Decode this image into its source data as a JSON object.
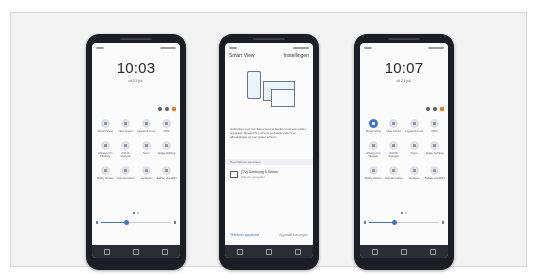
{
  "phones": [
    {
      "clock": "10:03",
      "date": "di 21 jul.",
      "tiles": [
        {
          "label": "Smart View",
          "active": false
        },
        {
          "label": "Niet storen",
          "active": false
        },
        {
          "label": "Liggend mod.",
          "active": false
        },
        {
          "label": "NFC",
          "active": false
        },
        {
          "label": "Always On Display",
          "active": false
        },
        {
          "label": "Zichtb. wijzigen",
          "active": false
        },
        {
          "label": "Sync",
          "active": false
        },
        {
          "label": "Edge lighting",
          "active": false
        },
        {
          "label": "Dolby Atmos",
          "active": false
        },
        {
          "label": "Gamemodus",
          "active": false
        },
        {
          "label": "Hotspot",
          "active": false
        },
        {
          "label": "Bellen via WiFi",
          "active": false
        }
      ],
      "brightness": 0.35
    },
    {
      "smart_view": {
        "title": "Smart View",
        "settings": "Instellingen",
        "description": "Gebruiken voor het delen van uw telefoon met een ander apparaat. Spiegel het scherm en bekijk video's en afbeeldingen op een groter scherm.",
        "section": "Beschikbare apparaten",
        "device_name": "[TV] Samsung 6 Series",
        "device_sub": "Scherm spiegelen",
        "bottom_left": "Telefoon apparaat",
        "bottom_right": "Apparaat toevoegen"
      }
    },
    {
      "clock": "10:07",
      "date": "di 21 jul.",
      "tiles": [
        {
          "label": "Smart View",
          "active": true
        },
        {
          "label": "Niet storen",
          "active": false
        },
        {
          "label": "Liggend mod.",
          "active": false
        },
        {
          "label": "NFC",
          "active": false
        },
        {
          "label": "Always On Display",
          "active": false
        },
        {
          "label": "Zichtb. wijzigen",
          "active": false
        },
        {
          "label": "Sync",
          "active": false
        },
        {
          "label": "Edge lighting",
          "active": false
        },
        {
          "label": "Dolby Atmos",
          "active": false
        },
        {
          "label": "Gamemodus",
          "active": false
        },
        {
          "label": "Hotspot",
          "active": false
        },
        {
          "label": "Bellen via WiFi",
          "active": false
        }
      ],
      "brightness": 0.35
    }
  ],
  "colors": {
    "accent": "#3f72c9",
    "notification": "#f07a1f",
    "bezel": "#1b1e24"
  },
  "icons": {
    "quick_settings": [
      "settings-gear-icon",
      "more-dots-icon",
      "notification-icon"
    ],
    "nav": [
      "recent-apps-icon",
      "home-icon",
      "back-icon"
    ]
  }
}
